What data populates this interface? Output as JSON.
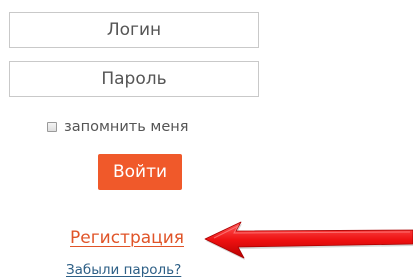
{
  "login_form": {
    "login_placeholder": "Логин",
    "password_placeholder": "Пароль",
    "remember_label": "запомнить меня",
    "remember_checked": false,
    "submit_label": "Войти",
    "register_link": "Регистрация",
    "forgot_link": "Забыли пароль?"
  },
  "annotation": {
    "arrow_icon": "red-arrow-icon",
    "arrow_color": "#ee1111"
  },
  "colors": {
    "accent": "#f0592a",
    "register_link": "#e05428",
    "forgot_link": "#2d5f86",
    "text": "#555555",
    "border": "#c9c9c9"
  }
}
